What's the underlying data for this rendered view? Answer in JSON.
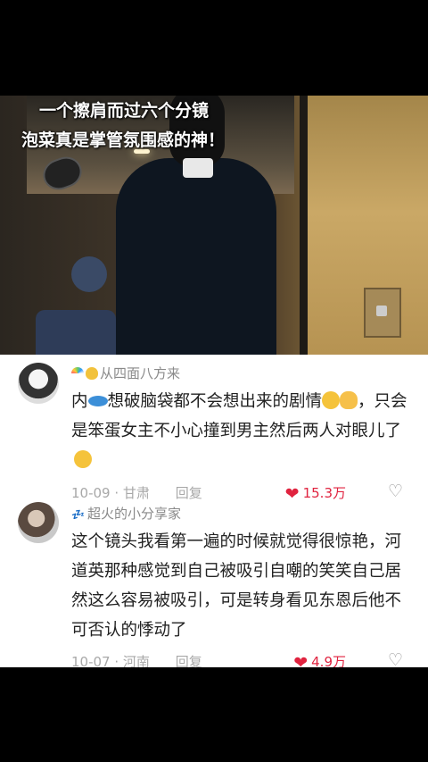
{
  "video": {
    "caption_line1": "一个擦肩而过六个分镜",
    "caption_line2": "泡菜真是掌管氛围感的神！"
  },
  "comments": [
    {
      "username": "从四面八方来",
      "text_part1": "内",
      "text_part2": "想破脑袋都不会想出来的剧情",
      "text_part3": "，只会是笨蛋女主不小心撞到男主然后两人对眼儿了",
      "date": "10-09",
      "region": "甘肃",
      "reply_label": "回复",
      "likes": "15.3万"
    },
    {
      "username": "超火的小分享家",
      "text": "这个镜头我看第一遍的时候就觉得很惊艳，河道英那种感觉到自己被吸引自嘲的笑笑自己居然这么容易被吸引，可是转身看见东恩后他不可否认的悸动了",
      "date": "10-07",
      "region": "河南",
      "reply_label": "回复",
      "likes": "4.9万"
    }
  ],
  "icons": {
    "heart": "heart-icon",
    "dislike": "broken-heart-icon",
    "accent_color": "#e0233f"
  }
}
